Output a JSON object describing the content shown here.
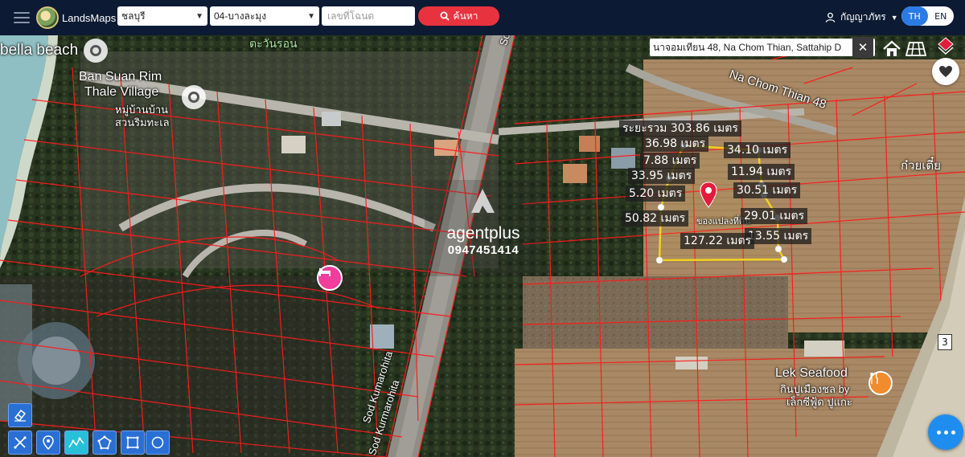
{
  "app": {
    "brand": "LandsMaps"
  },
  "search": {
    "province": "ชลบุรี",
    "district": "04-บางละมุง",
    "deed_placeholder": "เลขที่โฉนด",
    "search_label": "ค้นหา"
  },
  "user": {
    "name": "กัญญาภัทร"
  },
  "lang": {
    "th": "TH",
    "en": "EN",
    "active": "TH"
  },
  "address": {
    "text": "นาจอมเทียน 48, Na Chom Thian, Sattahip D"
  },
  "places": {
    "bella_beach": "bella beach",
    "ban_suan_rim_1": "Ban Suan Rim",
    "ban_suan_rim_2": "Thale Village",
    "village_thai_1": "หมู่บ้านบ้าน",
    "village_thai_2": "สวนริมทะเล",
    "tawan_ron": "ตะวันรอน",
    "sod_kumar_top": "Sod Kuma",
    "sod_kumarohita": "Sod Kumarohita",
    "sod_kurmarohita": "Sod Kurmarohita",
    "na_chom_thian_48": "Na Chom Thian 48",
    "kuay_tiew": "ก๋วยเตี๋ย",
    "lek_seafood": "Lek Seafood",
    "lek_seafood_thai_1": "กินปูเมืองชล by",
    "lek_seafood_thai_2": "เล็กซีฟู้ด ปูแกะ",
    "parcel_label": "ของแปลงที่ดิน",
    "highway": "3"
  },
  "watermark": {
    "brand": "agentplus",
    "phone": "0947451414"
  },
  "measurements": [
    {
      "id": "m1",
      "text": "ระยะรวม 303.86 เมตร"
    },
    {
      "id": "m2",
      "text": "36.98 เมตร"
    },
    {
      "id": "m3",
      "text": "34.10 เมตร"
    },
    {
      "id": "m4",
      "text": "7.88 เมตร"
    },
    {
      "id": "m5",
      "text": "11.94 เมตร"
    },
    {
      "id": "m6",
      "text": "33.95 เมตร"
    },
    {
      "id": "m7",
      "text": "30.51 เมตร"
    },
    {
      "id": "m8",
      "text": "5.20 เมตร"
    },
    {
      "id": "m9",
      "text": "29.01 เมตร"
    },
    {
      "id": "m10",
      "text": "50.82 เมตร"
    },
    {
      "id": "m11",
      "text": "13.55 เมตร"
    },
    {
      "id": "m12",
      "text": "127.22 เมตร"
    }
  ],
  "colors": {
    "topbar": "#0c1a33",
    "accent": "#e8333e",
    "lang_active": "#2c7be5",
    "parcel_line": "#ff1a1a",
    "polygon": "#f2d023",
    "fab": "#1f8df0"
  },
  "icons": {
    "menu": "hamburger-icon",
    "search": "search-icon",
    "user": "user-icon",
    "close": "close-icon",
    "home": "home-icon",
    "layers": "grid-layer-icon",
    "pin": "map-pin-icon",
    "heart": "heart-icon",
    "eraser": "eraser-icon",
    "ruler": "ruler-icon",
    "location": "location-icon",
    "line": "polyline-icon",
    "polygon": "polygon-icon",
    "rectangle": "rectangle-icon",
    "circle": "circle-icon",
    "more": "more-icon"
  }
}
